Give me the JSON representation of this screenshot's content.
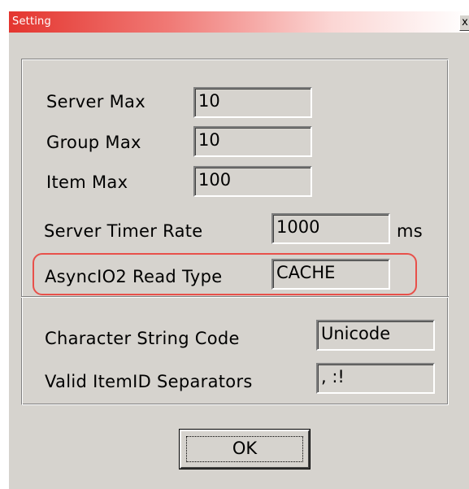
{
  "window": {
    "title": "Setting",
    "close_glyph": "x"
  },
  "fields": {
    "server_max": {
      "label": "Server Max",
      "value": "10"
    },
    "group_max": {
      "label": "Group Max",
      "value": "10"
    },
    "item_max": {
      "label": "Item Max",
      "value": "100"
    },
    "server_timer_rate": {
      "label": "Server Timer Rate",
      "value": "1000",
      "unit": "ms"
    },
    "async_io2_read_type": {
      "label": "AsyncIO2 Read Type",
      "value": "CACHE"
    },
    "character_string_code": {
      "label": "Character String Code",
      "value": "Unicode"
    },
    "valid_itemid_separators": {
      "label": "Valid ItemID Separators",
      "value": ", :!"
    }
  },
  "buttons": {
    "ok_label": "OK"
  },
  "colors": {
    "dialog_bg": "#d6d3ce",
    "titlebar_start": "#e4352f",
    "highlight_outline": "#e8504a"
  }
}
